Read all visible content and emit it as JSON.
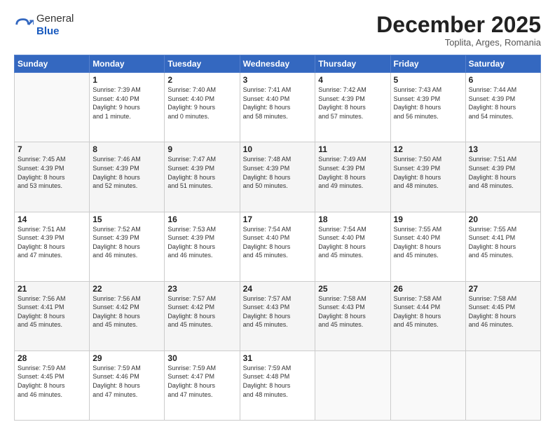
{
  "header": {
    "logo_general": "General",
    "logo_blue": "Blue",
    "month": "December 2025",
    "location": "Toplita, Arges, Romania"
  },
  "weekdays": [
    "Sunday",
    "Monday",
    "Tuesday",
    "Wednesday",
    "Thursday",
    "Friday",
    "Saturday"
  ],
  "weeks": [
    [
      {
        "day": "",
        "info": ""
      },
      {
        "day": "1",
        "info": "Sunrise: 7:39 AM\nSunset: 4:40 PM\nDaylight: 9 hours\nand 1 minute."
      },
      {
        "day": "2",
        "info": "Sunrise: 7:40 AM\nSunset: 4:40 PM\nDaylight: 9 hours\nand 0 minutes."
      },
      {
        "day": "3",
        "info": "Sunrise: 7:41 AM\nSunset: 4:40 PM\nDaylight: 8 hours\nand 58 minutes."
      },
      {
        "day": "4",
        "info": "Sunrise: 7:42 AM\nSunset: 4:39 PM\nDaylight: 8 hours\nand 57 minutes."
      },
      {
        "day": "5",
        "info": "Sunrise: 7:43 AM\nSunset: 4:39 PM\nDaylight: 8 hours\nand 56 minutes."
      },
      {
        "day": "6",
        "info": "Sunrise: 7:44 AM\nSunset: 4:39 PM\nDaylight: 8 hours\nand 54 minutes."
      }
    ],
    [
      {
        "day": "7",
        "info": "Sunrise: 7:45 AM\nSunset: 4:39 PM\nDaylight: 8 hours\nand 53 minutes."
      },
      {
        "day": "8",
        "info": "Sunrise: 7:46 AM\nSunset: 4:39 PM\nDaylight: 8 hours\nand 52 minutes."
      },
      {
        "day": "9",
        "info": "Sunrise: 7:47 AM\nSunset: 4:39 PM\nDaylight: 8 hours\nand 51 minutes."
      },
      {
        "day": "10",
        "info": "Sunrise: 7:48 AM\nSunset: 4:39 PM\nDaylight: 8 hours\nand 50 minutes."
      },
      {
        "day": "11",
        "info": "Sunrise: 7:49 AM\nSunset: 4:39 PM\nDaylight: 8 hours\nand 49 minutes."
      },
      {
        "day": "12",
        "info": "Sunrise: 7:50 AM\nSunset: 4:39 PM\nDaylight: 8 hours\nand 48 minutes."
      },
      {
        "day": "13",
        "info": "Sunrise: 7:51 AM\nSunset: 4:39 PM\nDaylight: 8 hours\nand 48 minutes."
      }
    ],
    [
      {
        "day": "14",
        "info": "Sunrise: 7:51 AM\nSunset: 4:39 PM\nDaylight: 8 hours\nand 47 minutes."
      },
      {
        "day": "15",
        "info": "Sunrise: 7:52 AM\nSunset: 4:39 PM\nDaylight: 8 hours\nand 46 minutes."
      },
      {
        "day": "16",
        "info": "Sunrise: 7:53 AM\nSunset: 4:39 PM\nDaylight: 8 hours\nand 46 minutes."
      },
      {
        "day": "17",
        "info": "Sunrise: 7:54 AM\nSunset: 4:40 PM\nDaylight: 8 hours\nand 45 minutes."
      },
      {
        "day": "18",
        "info": "Sunrise: 7:54 AM\nSunset: 4:40 PM\nDaylight: 8 hours\nand 45 minutes."
      },
      {
        "day": "19",
        "info": "Sunrise: 7:55 AM\nSunset: 4:40 PM\nDaylight: 8 hours\nand 45 minutes."
      },
      {
        "day": "20",
        "info": "Sunrise: 7:55 AM\nSunset: 4:41 PM\nDaylight: 8 hours\nand 45 minutes."
      }
    ],
    [
      {
        "day": "21",
        "info": "Sunrise: 7:56 AM\nSunset: 4:41 PM\nDaylight: 8 hours\nand 45 minutes."
      },
      {
        "day": "22",
        "info": "Sunrise: 7:56 AM\nSunset: 4:42 PM\nDaylight: 8 hours\nand 45 minutes."
      },
      {
        "day": "23",
        "info": "Sunrise: 7:57 AM\nSunset: 4:42 PM\nDaylight: 8 hours\nand 45 minutes."
      },
      {
        "day": "24",
        "info": "Sunrise: 7:57 AM\nSunset: 4:43 PM\nDaylight: 8 hours\nand 45 minutes."
      },
      {
        "day": "25",
        "info": "Sunrise: 7:58 AM\nSunset: 4:43 PM\nDaylight: 8 hours\nand 45 minutes."
      },
      {
        "day": "26",
        "info": "Sunrise: 7:58 AM\nSunset: 4:44 PM\nDaylight: 8 hours\nand 45 minutes."
      },
      {
        "day": "27",
        "info": "Sunrise: 7:58 AM\nSunset: 4:45 PM\nDaylight: 8 hours\nand 46 minutes."
      }
    ],
    [
      {
        "day": "28",
        "info": "Sunrise: 7:59 AM\nSunset: 4:45 PM\nDaylight: 8 hours\nand 46 minutes."
      },
      {
        "day": "29",
        "info": "Sunrise: 7:59 AM\nSunset: 4:46 PM\nDaylight: 8 hours\nand 47 minutes."
      },
      {
        "day": "30",
        "info": "Sunrise: 7:59 AM\nSunset: 4:47 PM\nDaylight: 8 hours\nand 47 minutes."
      },
      {
        "day": "31",
        "info": "Sunrise: 7:59 AM\nSunset: 4:48 PM\nDaylight: 8 hours\nand 48 minutes."
      },
      {
        "day": "",
        "info": ""
      },
      {
        "day": "",
        "info": ""
      },
      {
        "day": "",
        "info": ""
      }
    ]
  ]
}
